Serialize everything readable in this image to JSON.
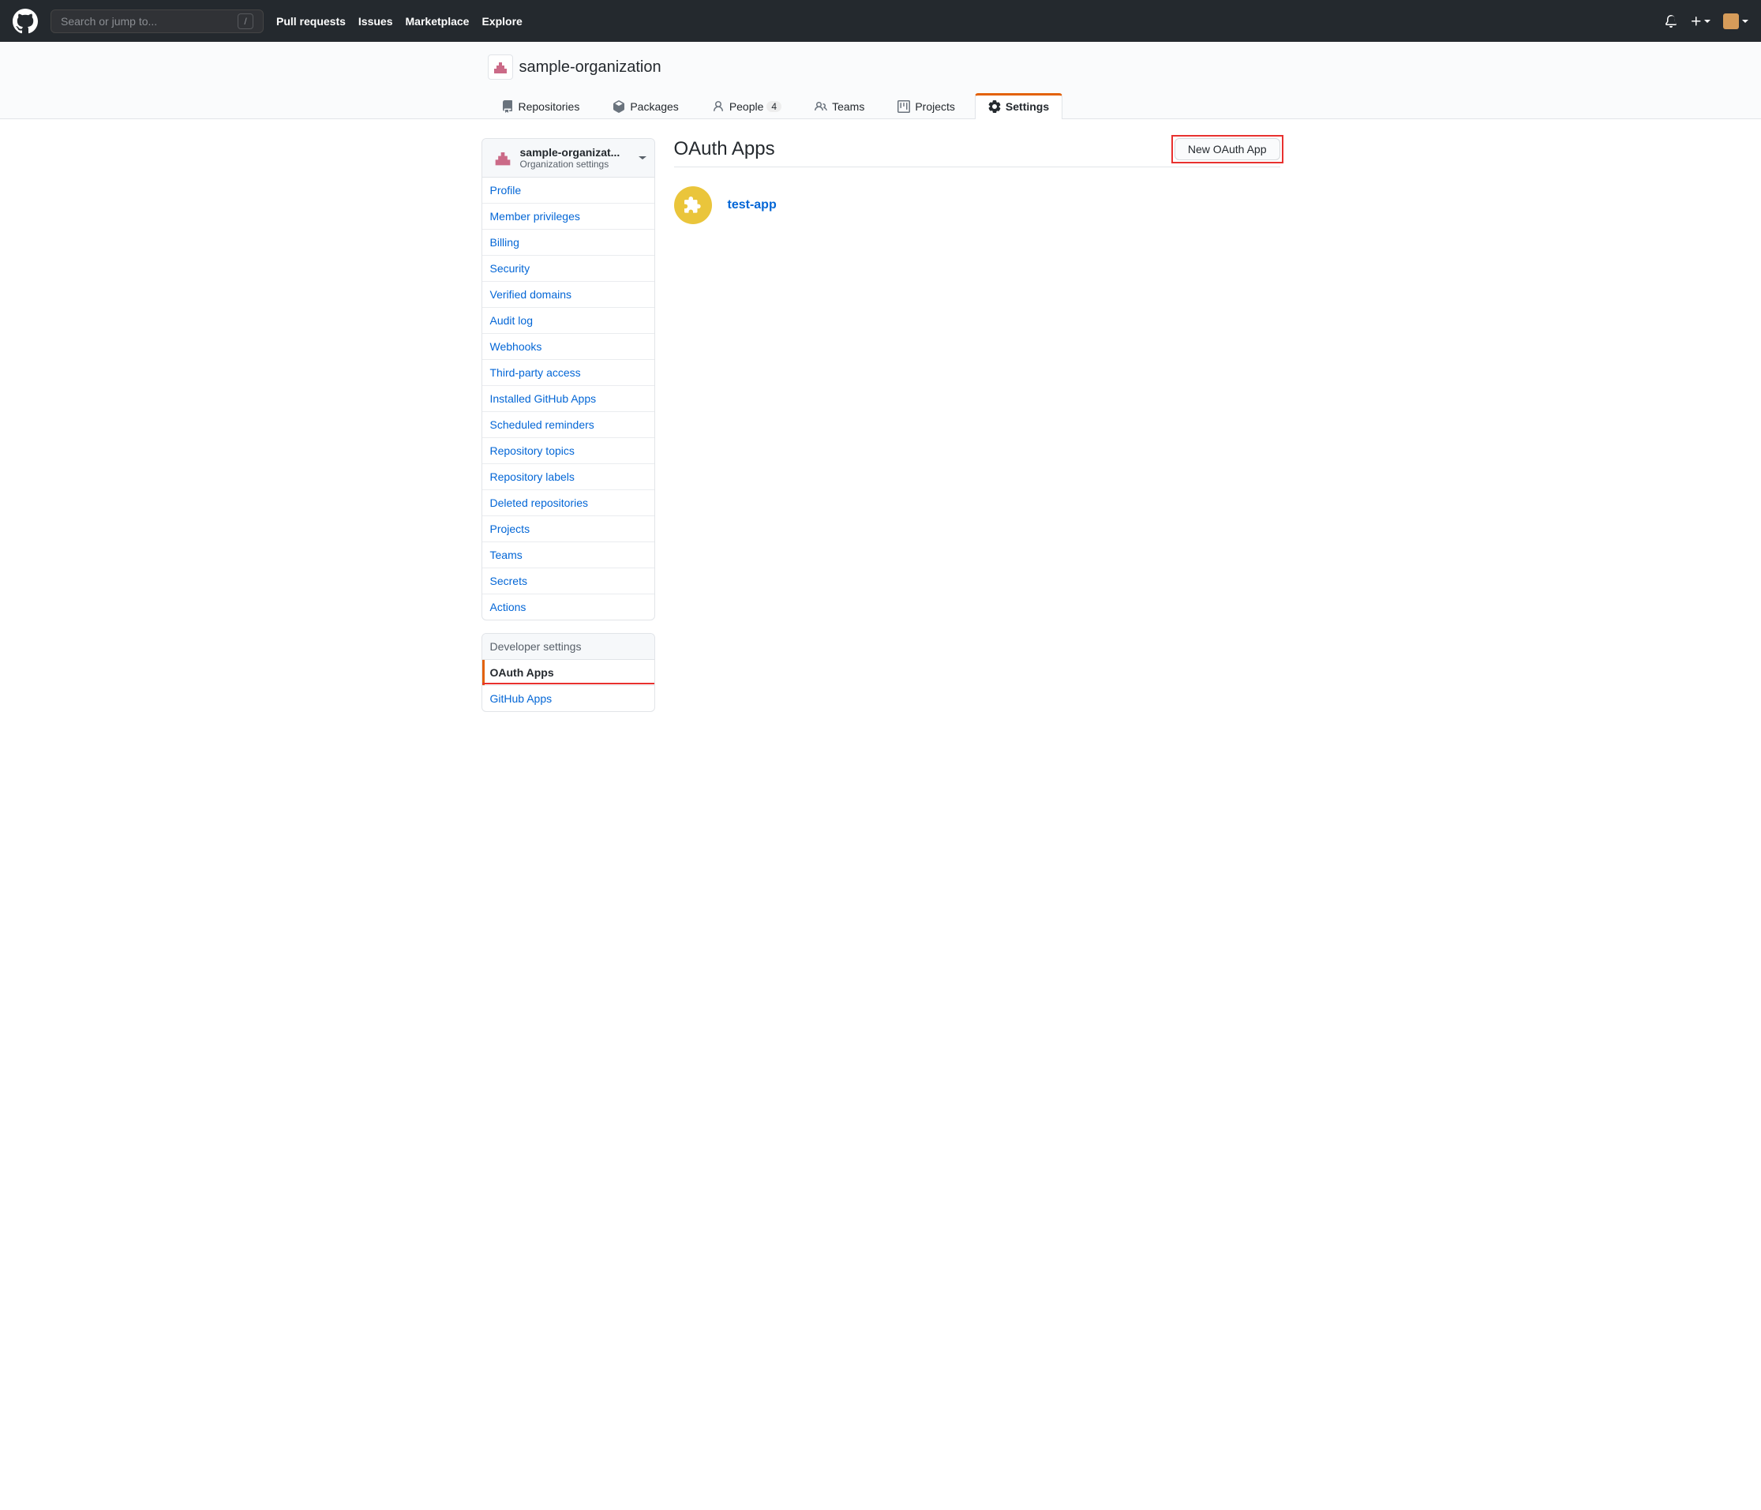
{
  "header": {
    "search_placeholder": "Search or jump to...",
    "slash": "/",
    "nav": {
      "pull_requests": "Pull requests",
      "issues": "Issues",
      "marketplace": "Marketplace",
      "explore": "Explore"
    }
  },
  "org": {
    "name": "sample-organization",
    "tabs": {
      "repositories": "Repositories",
      "packages": "Packages",
      "people": "People",
      "people_count": "4",
      "teams": "Teams",
      "projects": "Projects",
      "settings": "Settings"
    }
  },
  "sidebar": {
    "context": {
      "title": "sample-organizat...",
      "subtitle": "Organization settings"
    },
    "items": [
      "Profile",
      "Member privileges",
      "Billing",
      "Security",
      "Verified domains",
      "Audit log",
      "Webhooks",
      "Third-party access",
      "Installed GitHub Apps",
      "Scheduled reminders",
      "Repository topics",
      "Repository labels",
      "Deleted repositories",
      "Projects",
      "Teams",
      "Secrets",
      "Actions"
    ],
    "dev": {
      "heading": "Developer settings",
      "oauth": "OAuth Apps",
      "github_apps": "GitHub Apps"
    }
  },
  "content": {
    "title": "OAuth Apps",
    "new_button": "New OAuth App",
    "app": {
      "name": "test-app"
    }
  }
}
